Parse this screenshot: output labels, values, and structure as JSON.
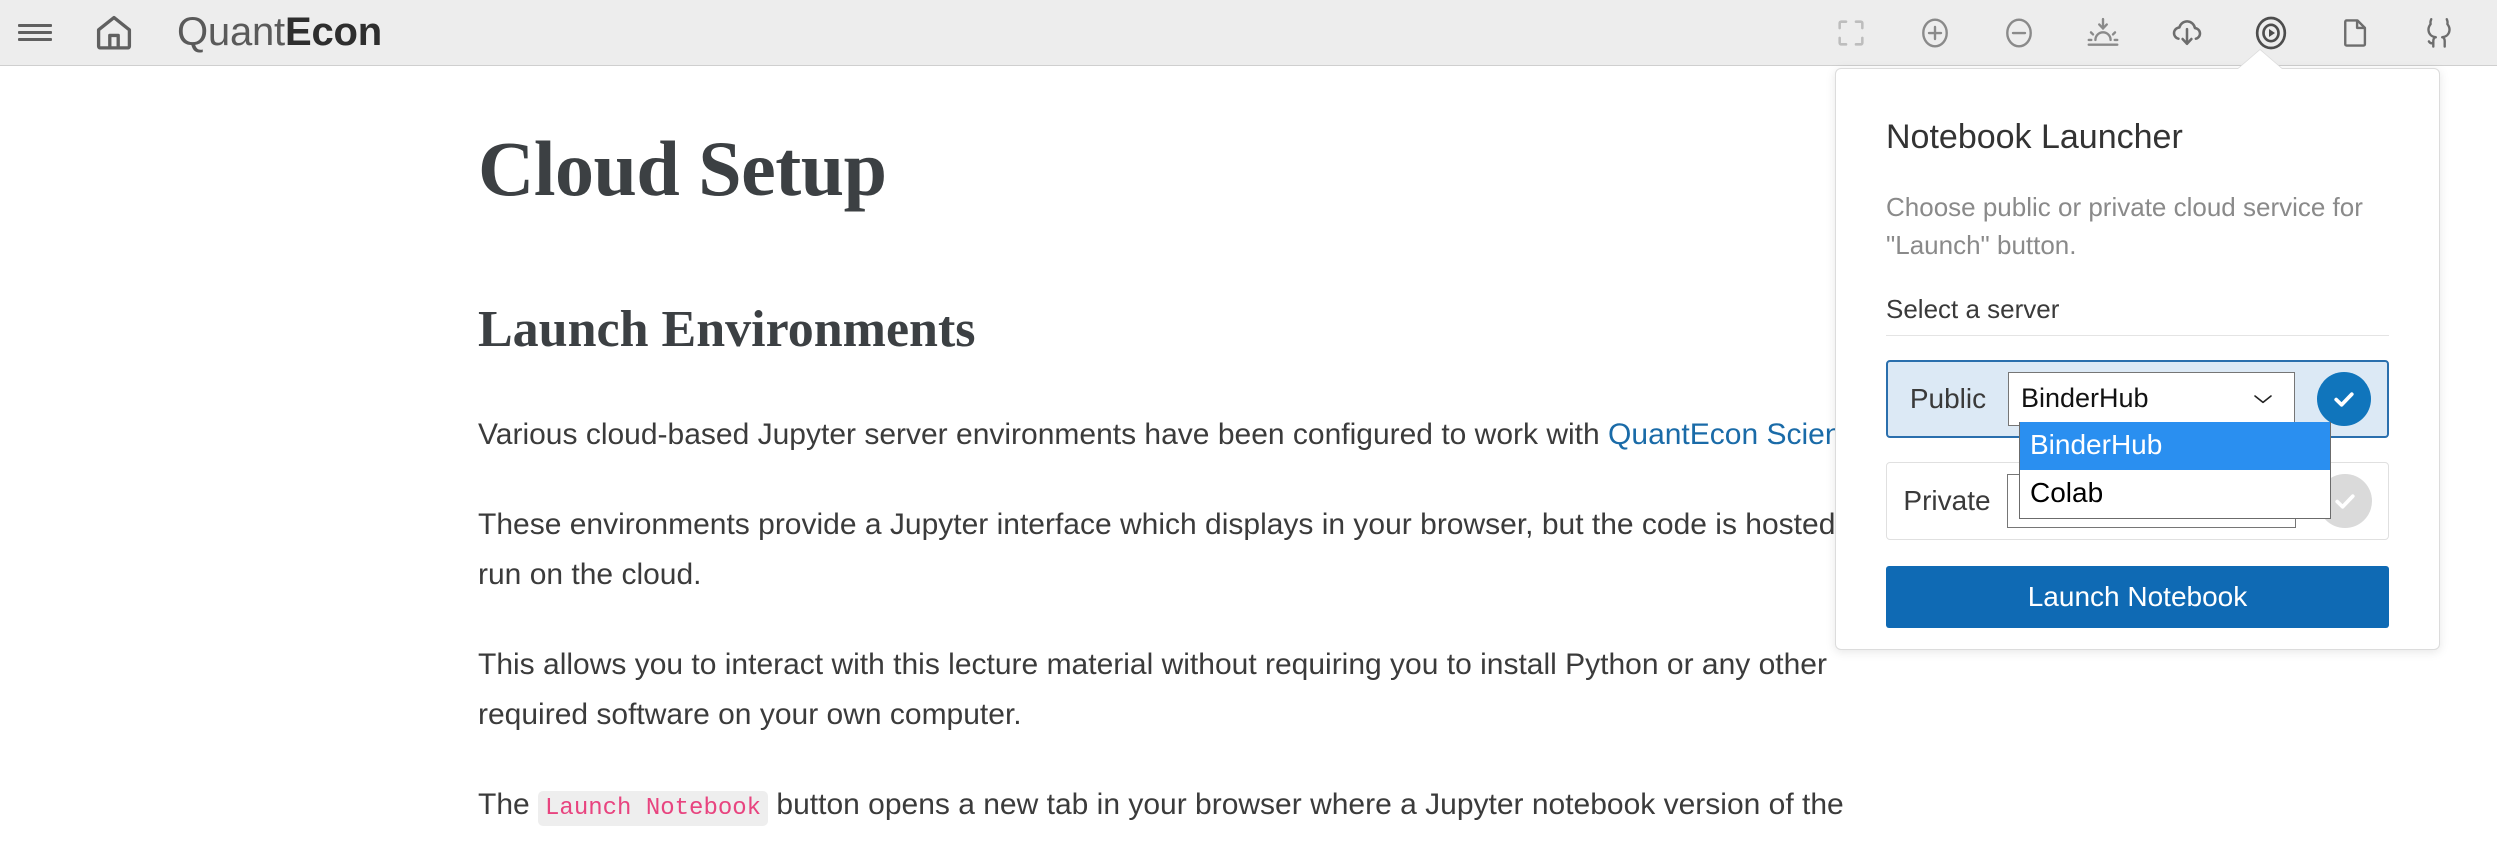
{
  "header": {
    "menu_icon": "hamburger-menu-icon",
    "home_icon": "home-icon",
    "brand_light": "Quant",
    "brand_bold": "Econ",
    "tools": [
      {
        "name": "fullscreen-icon",
        "label": "Fullscreen"
      },
      {
        "name": "zoom-in-icon",
        "label": "Zoom in"
      },
      {
        "name": "zoom-out-icon",
        "label": "Zoom out"
      },
      {
        "name": "theme-toggle-icon",
        "label": "Theme"
      },
      {
        "name": "download-cloud-icon",
        "label": "Download"
      },
      {
        "name": "launch-play-icon",
        "label": "Launch"
      },
      {
        "name": "file-icon",
        "label": "Source file"
      },
      {
        "name": "github-icon",
        "label": "GitHub"
      }
    ]
  },
  "document": {
    "title": "Cloud Setup",
    "section_title": "Launch Environments",
    "p1_before_link": "Various cloud-based Jupyter server environments have been configured to work with ",
    "p1_link": "QuantEcon Science",
    "p1_after_link": ".",
    "p2": "These environments provide a Jupyter interface which displays in your browser, but the code is hosted and run on the cloud.",
    "p3": "This allows you to interact with this lecture material without requiring you to install Python or any other required software on your own computer.",
    "p4_before_code": "The ",
    "p4_code": "Launch Notebook",
    "p4_after_code": " button opens a new tab in your browser where a Jupyter notebook version of the"
  },
  "popup": {
    "title": "Notebook Launcher",
    "description": "Choose public or private cloud service for \"Launch\" button.",
    "select_label": "Select a server",
    "public_row": {
      "label": "Public",
      "selected_value": "BinderHub",
      "checked": "checked"
    },
    "private_row": {
      "label": "Private",
      "value": "",
      "placeholder": ""
    },
    "dropdown_options": [
      {
        "label": "BinderHub",
        "state": "highlighted"
      },
      {
        "label": "Colab",
        "state": "normal"
      }
    ],
    "launch_button": "Launch Notebook"
  },
  "colors": {
    "header_bg": "#ededed",
    "accent_blue": "#0f6ab4",
    "selected_row_bg": "#dce9f5",
    "selected_row_border": "#2a6fad",
    "dropdown_highlight": "#2a8ff0",
    "link": "#1a6ba8",
    "code_text": "#e8447f"
  }
}
